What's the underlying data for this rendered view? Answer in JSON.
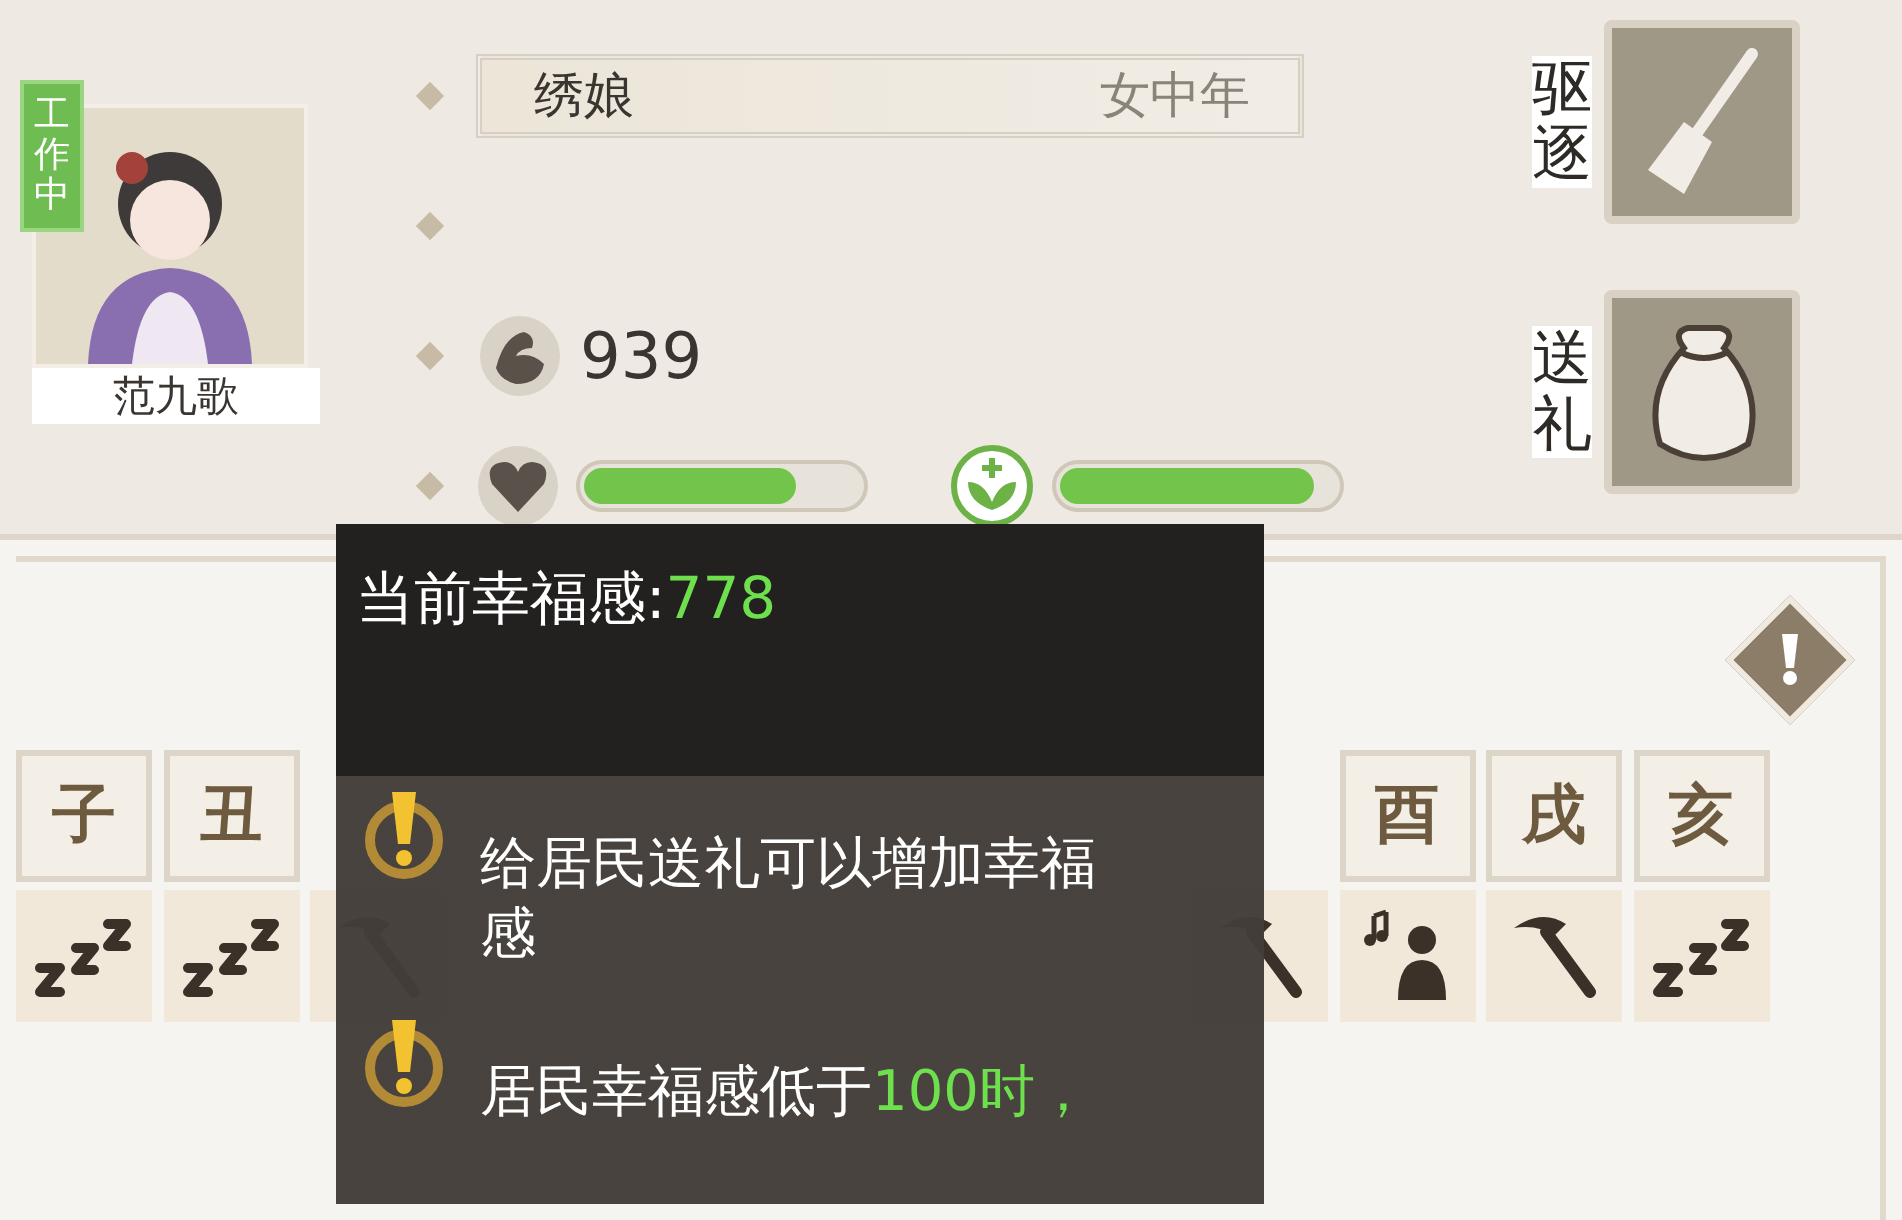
{
  "resident": {
    "status": "工作中",
    "name": "范九歌",
    "job": "绣娘",
    "category": "女中年",
    "strength": "939",
    "mood": {
      "level": 0.77
    },
    "health": {
      "level": 0.92
    }
  },
  "actions": [
    {
      "label": "驱逐",
      "kind": "broom"
    },
    {
      "label": "送礼",
      "kind": "bag"
    }
  ],
  "schedule_left": [
    {
      "hour": "子",
      "kind": "sleep"
    },
    {
      "hour": "丑",
      "kind": "sleep"
    },
    {
      "kind": "work"
    }
  ],
  "schedule_right": [
    {
      "kind": "work"
    },
    {
      "hour": "酉",
      "kind": "music"
    },
    {
      "hour": "戌",
      "kind": "work"
    },
    {
      "hour": "亥",
      "kind": "sleep"
    }
  ],
  "tooltip": {
    "title": "当前幸福感:",
    "value": "778",
    "tips": [
      {
        "text": "给居民送礼可以增加幸福感"
      },
      {
        "text": "居民幸福感低于",
        "highlight": "100时，"
      }
    ]
  }
}
